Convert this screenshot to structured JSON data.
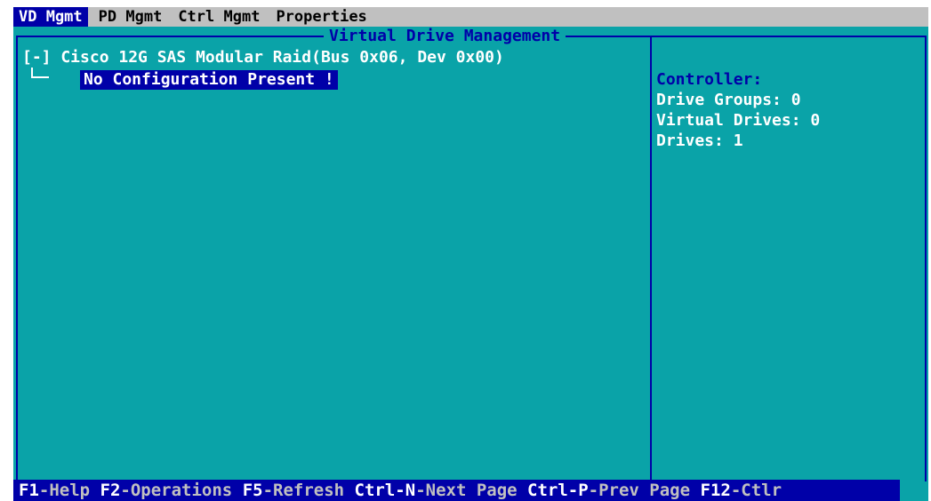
{
  "menu": {
    "items": [
      {
        "label": "VD Mgmt"
      },
      {
        "label": "PD Mgmt"
      },
      {
        "label": "Ctrl Mgmt"
      },
      {
        "label": "Properties"
      }
    ],
    "active_index": 0
  },
  "panel": {
    "title": "Virtual Drive Management"
  },
  "tree": {
    "root": "[-] Cisco 12G SAS Modular Raid(Bus 0x06, Dev 0x00)",
    "child": "No Configuration Present !"
  },
  "info": {
    "heading": "Controller:",
    "drive_groups": "Drive Groups: 0",
    "virtual_drives": "Virtual Drives: 0",
    "drives": "Drives: 1"
  },
  "statusbar": {
    "items": [
      {
        "key": "F1",
        "desc": "-Help "
      },
      {
        "key": "F2",
        "desc": "-Operations "
      },
      {
        "key": "F5",
        "desc": "-Refresh "
      },
      {
        "key": "Ctrl-N",
        "desc": "-Next Page "
      },
      {
        "key": "Ctrl-P",
        "desc": "-Prev Page "
      },
      {
        "key": "F12",
        "desc": "-Ctlr"
      }
    ]
  },
  "colors": {
    "screen_background": "#0aa3a8",
    "highlight": "#0000a8",
    "menubar": "#c0c0c0",
    "text": "#ffffff"
  }
}
